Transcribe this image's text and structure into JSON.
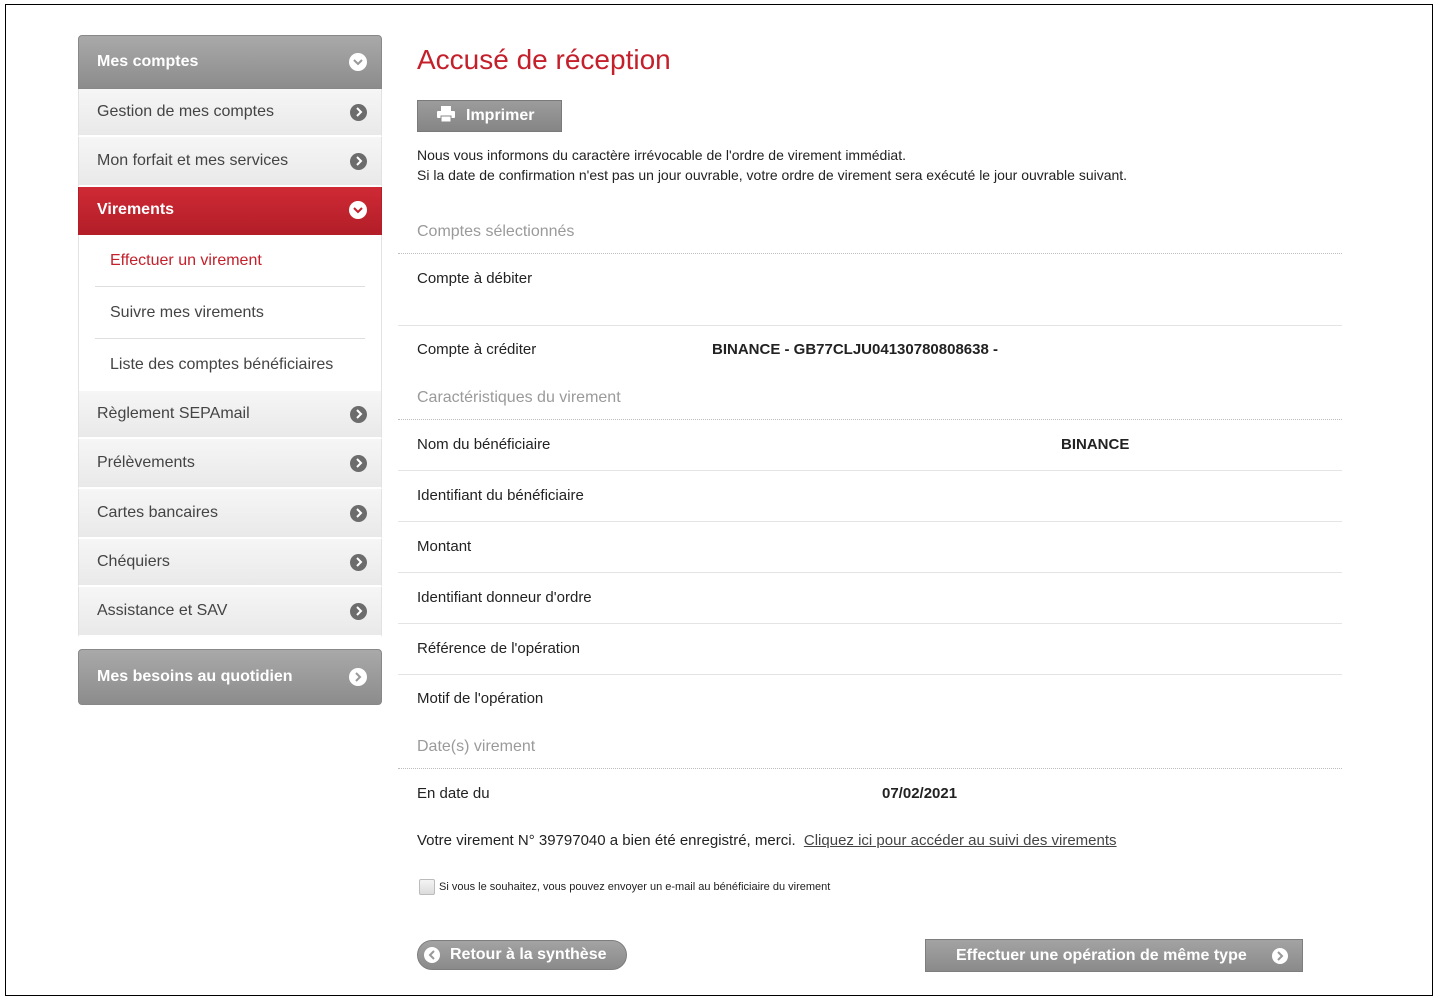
{
  "sidebar": {
    "section1": "Mes comptes",
    "items": [
      {
        "label": "Gestion de mes comptes"
      },
      {
        "label": "Mon forfait et mes services"
      },
      {
        "label": "Virements"
      }
    ],
    "sub_items": [
      {
        "label": "Effectuer un virement"
      },
      {
        "label": "Suivre mes virements"
      },
      {
        "label": "Liste des comptes bénéficiaires"
      }
    ],
    "items2": [
      {
        "label": "Règlement SEPAmail"
      },
      {
        "label": "Prélèvements"
      },
      {
        "label": "Cartes bancaires"
      },
      {
        "label": "Chéquiers"
      },
      {
        "label": "Assistance et SAV"
      }
    ],
    "section2": "Mes besoins au quotidien"
  },
  "main": {
    "title": "Accusé de réception",
    "print_label": "Imprimer",
    "info_line1": "Nous vous informons du caractère irrévocable de l'ordre de virement immédiat.",
    "info_line2": "Si la date de confirmation n'est pas un jour ouvrable, votre ordre de virement sera exécuté le jour ouvrable suivant.",
    "section_accounts": "Comptes sélectionnés",
    "debit_label": "Compte à débiter",
    "credit_label": "Compte à créditer",
    "credit_value": "BINANCE - GB77CLJU04130780808638 -",
    "section_details": "Caractéristiques du virement",
    "beneficiary_name_label": "Nom du bénéficiaire",
    "beneficiary_name_value": "BINANCE",
    "beneficiary_id_label": "Identifiant du bénéficiaire",
    "amount_label": "Montant",
    "ordering_id_label": "Identifiant donneur d'ordre",
    "reference_label": "Référence de l'opération",
    "reason_label": "Motif de l'opération",
    "section_dates": "Date(s) virement",
    "date_label": "En date du",
    "date_value": "07/02/2021",
    "confirm_text": "Votre virement N° 39797040 a bien été enregistré, merci.",
    "confirm_link": "Cliquez ici pour accéder au suivi des virements",
    "email_checkbox_label": "Si vous le souhaitez, vous pouvez envoyer un e-mail au bénéficiaire du virement",
    "back_label": "Retour à la synthèse",
    "same_type_label": "Effectuer une opération de même type"
  },
  "colors": {
    "accent": "#c4202b",
    "button_grey": "#8c8c8c"
  }
}
